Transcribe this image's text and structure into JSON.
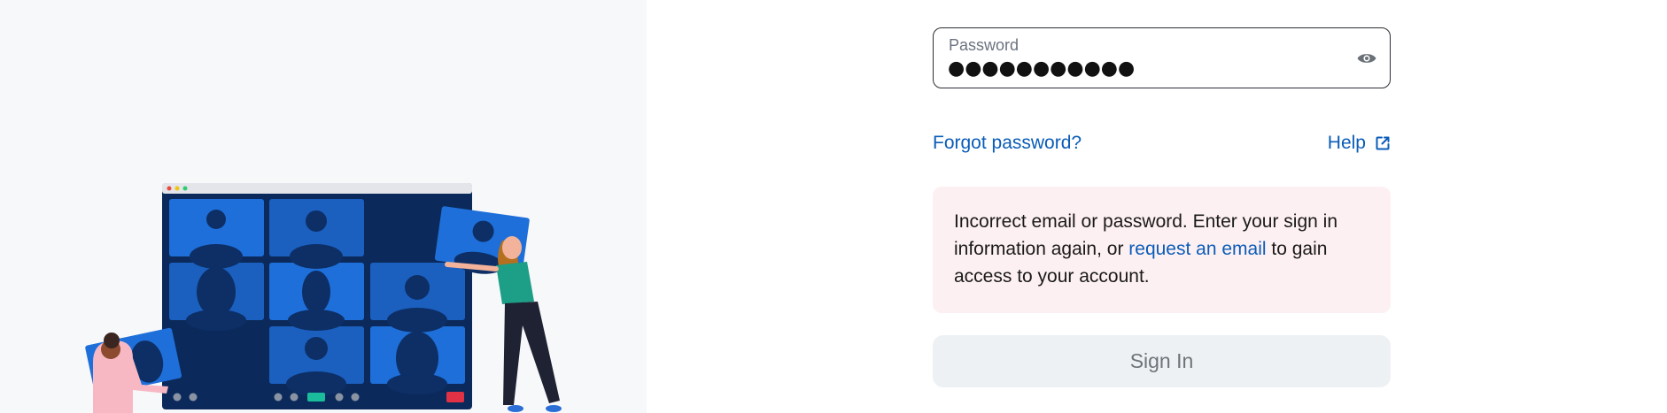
{
  "password": {
    "label": "Password",
    "value": "●●●●●●●●●●●",
    "toggle_icon": "eye-icon"
  },
  "links": {
    "forgot": "Forgot password?",
    "help": "Help",
    "help_icon": "external-link-icon"
  },
  "error": {
    "text_before": "Incorrect email or password. Enter your sign in information again, or ",
    "link_text": "request an email",
    "text_after": " to gain access to your account."
  },
  "signin": {
    "label": "Sign In"
  },
  "colors": {
    "link": "#0a5cb8",
    "error_bg": "#fdf0f2",
    "button_bg": "#eef1f4",
    "panel_bg": "#f7f8fa"
  }
}
